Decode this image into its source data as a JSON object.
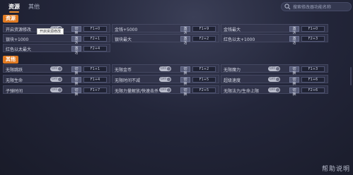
{
  "tabs": [
    {
      "label": "资源",
      "active": true
    },
    {
      "label": "其他",
      "active": false
    }
  ],
  "search": {
    "placeholder": "搜索修改器功能名称"
  },
  "sections": [
    {
      "title": "资源"
    },
    {
      "title": "其他"
    }
  ],
  "resources": [
    {
      "name": "开启资源修改",
      "control": "toggle",
      "toggle_state": "OFF",
      "action": "切换",
      "key": "F1+0"
    },
    {
      "name": "金钱+5000",
      "control": "button",
      "action": "激活",
      "key": "F1+9"
    },
    {
      "name": "金钱最大",
      "control": "button",
      "action": "激活",
      "key": "F1+0"
    },
    {
      "name": "银块+1000",
      "control": "button",
      "action": "激活",
      "key": "F2+1"
    },
    {
      "name": "银块最大",
      "control": "button",
      "action": "激活",
      "key": "F2+2"
    },
    {
      "name": "红色以太+1000",
      "control": "button",
      "action": "激活",
      "key": "F2+3"
    },
    {
      "name": "红色以太最大",
      "control": "button",
      "action": "激活",
      "key": "F2+4"
    }
  ],
  "tooltip": "开启资源修改",
  "others": [
    {
      "name": "无限跳跃",
      "toggle_state": "OFF",
      "action": "切换",
      "key": "F1+1"
    },
    {
      "name": "无限金币",
      "toggle_state": "OFF",
      "action": "切换",
      "key": "F1+2"
    },
    {
      "name": "无限魔力",
      "toggle_state": "OFF",
      "action": "切换",
      "key": "F1+3"
    },
    {
      "name": "无限生命",
      "toggle_state": "OFF",
      "action": "切换",
      "key": "F1+4"
    },
    {
      "name": "无限时间不减",
      "toggle_state": "OFF",
      "action": "切换",
      "key": "F1+5"
    },
    {
      "name": "超级速度",
      "toggle_state": "OFF",
      "action": "切换",
      "key": "F1+6"
    },
    {
      "name": "子弹时间",
      "toggle_state": "OFF",
      "action": "切换",
      "key": "F1+7"
    },
    {
      "name": "无限力量解放/快速击杀",
      "toggle_state": "OFF",
      "action": "切换",
      "key": "F2+5"
    },
    {
      "name": "无限法力/生命上限",
      "toggle_state": "OFF",
      "action": "切换",
      "key": "F2+6"
    }
  ],
  "help": "帮助说明",
  "colors": {
    "accent": "#e07a22",
    "background": "#23263a"
  }
}
